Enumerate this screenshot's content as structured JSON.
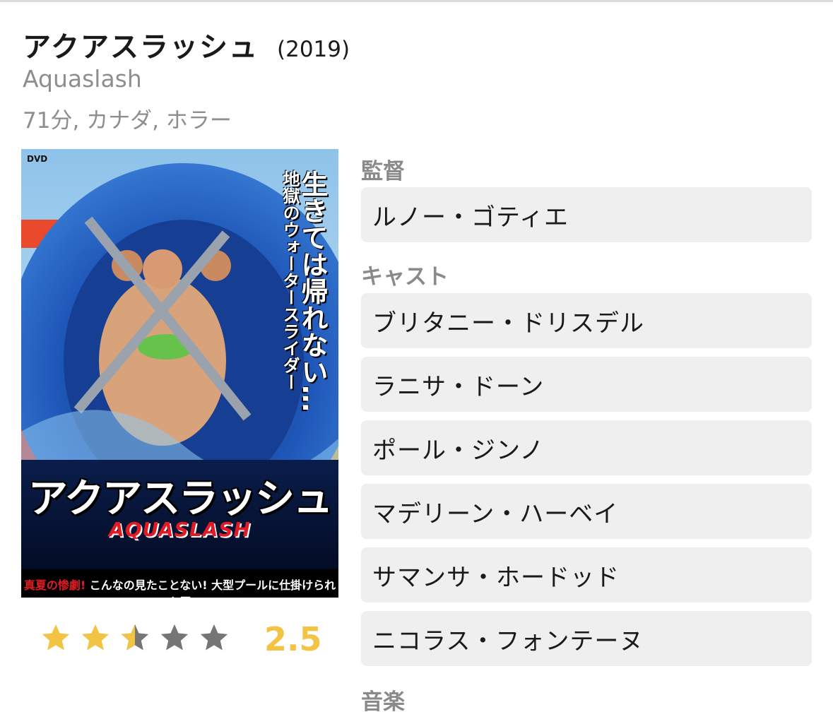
{
  "movie": {
    "title": "アクアスラッシュ",
    "year": "(2019)",
    "original_title": "Aquaslash",
    "meta": "71分, カナダ, ホラー"
  },
  "poster": {
    "title_jp": "アクアスラッシュ",
    "title_en": "AQUASLASH",
    "catch_1": "生きては帰れない…",
    "catch_2": "地獄のウォータースライダー",
    "tagline_red": "真夏の惨劇!",
    "tagline": " こんなの見たことない! 大型プールに仕掛けられた罠",
    "dvd_logo": "DVD VIDEO"
  },
  "rating": {
    "stars": 2.5,
    "max": 5,
    "value": "2.5",
    "filled_color": "#f3c343",
    "empty_color": "#757575"
  },
  "sections": {
    "director_label": "監督",
    "cast_label": "キャスト",
    "music_label": "音楽"
  },
  "director": [
    "ルノー・ゴティエ"
  ],
  "cast": [
    "ブリタニー・ドリスデル",
    "ラニサ・ドーン",
    "ポール・ジンノ",
    "マデリーン・ハーベイ",
    "サマンサ・ホードッド",
    "ニコラス・フォンテーヌ"
  ]
}
